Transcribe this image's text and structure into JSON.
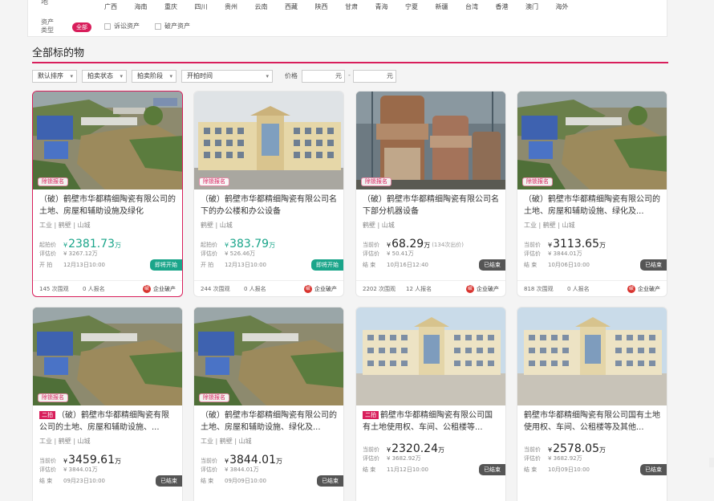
{
  "filters": {
    "region_label": "地",
    "regions": [
      "广西",
      "海南",
      "重庆",
      "四川",
      "贵州",
      "云南",
      "西藏",
      "陕西",
      "甘肃",
      "青海",
      "宁夏",
      "新疆",
      "台湾",
      "香港",
      "澳门",
      "海外"
    ],
    "asset_label": "资产类型",
    "asset_options": {
      "all": "全部",
      "litigation": "诉讼资产",
      "bankruptcy": "破产资产"
    }
  },
  "section": {
    "title": "全部标的物"
  },
  "sortbar": {
    "default_sort": "默认排序",
    "auction_status": "拍卖状态",
    "auction_stage": "拍卖阶段",
    "start_time": "开拍时间",
    "price_label": "价格",
    "unit_yuan": "元",
    "dash": "-"
  },
  "cards": [
    {
      "badge": "除锁报名",
      "title": "（破）鹤壁市华都精细陶瓷有限公司的土地、房屋和辅助设施及绿化",
      "location": "工业 | 鹤壁 | 山城",
      "price_label": "起拍价",
      "price": "2381.73",
      "unit": "万",
      "price_note": "",
      "row2_label": "评估价",
      "row2_value": "¥ 3267.12万",
      "row3_label": "开 拍",
      "row3_value": "12月13日10:00",
      "status": "即将开始",
      "views": "145 次围观",
      "signups": "0 人报名",
      "enterprise": "企业破产"
    },
    {
      "badge": "除锁报名",
      "title": "（破）鹤壁市华都精细陶瓷有限公司名下的办公楼和办公设备",
      "location": "鹤壁 | 山城",
      "price_label": "起拍价",
      "price": "383.79",
      "unit": "万",
      "price_note": "",
      "row2_label": "评估价",
      "row2_value": "¥ 526.46万",
      "row3_label": "开 拍",
      "row3_value": "12月13日10:00",
      "status": "即将开始",
      "views": "244 次围观",
      "signups": "0 人报名",
      "enterprise": "企业破产"
    },
    {
      "badge": "除锁报名",
      "title": "（破）鹤壁市华都精细陶瓷有限公司名下部分机器设备",
      "location": "鹤壁 | 山城",
      "price_label": "当前价",
      "price": "68.29",
      "unit": "万",
      "price_note": "(134次出价)",
      "row2_label": "评估价",
      "row2_value": "¥ 50.41万",
      "row3_label": "结 束",
      "row3_value": "10月16日12:40",
      "status": "已结束",
      "views": "2202 次围观",
      "signups": "12 人报名",
      "enterprise": "企业破产"
    },
    {
      "badge": "除锁报名",
      "title": "（破）鹤壁市华都精细陶瓷有限公司的土地、房屋和辅助设施、绿化及...",
      "location": "工业 | 鹤壁 | 山城",
      "price_label": "当前价",
      "price": "3113.65",
      "unit": "万",
      "price_note": "",
      "row2_label": "评估价",
      "row2_value": "¥ 3844.01万",
      "row3_label": "结 束",
      "row3_value": "10月06日10:00",
      "status": "已结束",
      "views": "818 次围观",
      "signups": "0 人报名",
      "enterprise": "企业破产"
    },
    {
      "badge": "除锁报名",
      "tag": "二拍",
      "title": "（破）鹤壁市华都精细陶瓷有限公司的土地、房屋和辅助设施、...",
      "location": "工业 | 鹤壁 | 山城",
      "price_label": "当前价",
      "price": "3459.61",
      "unit": "万",
      "price_note": "",
      "row2_label": "评估价",
      "row2_value": "¥ 3844.01万",
      "row3_label": "结 束",
      "row3_value": "09月23日10:00",
      "status": "已结束"
    },
    {
      "badge": "除锁报名",
      "title": "（破）鹤壁市华都精细陶瓷有限公司的土地、房屋和辅助设施、绿化及...",
      "location": "工业 | 鹤壁 | 山城",
      "price_label": "当前价",
      "price": "3844.01",
      "unit": "万",
      "price_note": "",
      "row2_label": "评估价",
      "row2_value": "¥ 3844.01万",
      "row3_label": "结 束",
      "row3_value": "09月09日10:00",
      "status": "已结束"
    },
    {
      "tag": "二拍",
      "title": "鹤壁市华都精细陶瓷有限公司国有土地使用权、车间、公租楼等...",
      "location": "",
      "price_label": "当前价",
      "price": "2320.24",
      "unit": "万",
      "price_note": "",
      "row2_label": "评估价",
      "row2_value": "¥ 3682.92万",
      "row3_label": "结 束",
      "row3_value": "11月12日10:00",
      "status": "已结束"
    },
    {
      "title": "鹤壁市华都精细陶瓷有限公司国有土地使用权、车间、公租楼等及其他...",
      "location": "",
      "price_label": "当前价",
      "price": "2578.05",
      "unit": "万",
      "price_note": "",
      "row2_label": "评估价",
      "row2_value": "¥ 3682.92万",
      "row3_label": "结 束",
      "row3_value": "10月09日10:00",
      "status": "已结束"
    }
  ],
  "currency": "¥",
  "colors": {
    "accent": "#d81e5b",
    "green": "#1aa58a",
    "ended": "#555555"
  }
}
